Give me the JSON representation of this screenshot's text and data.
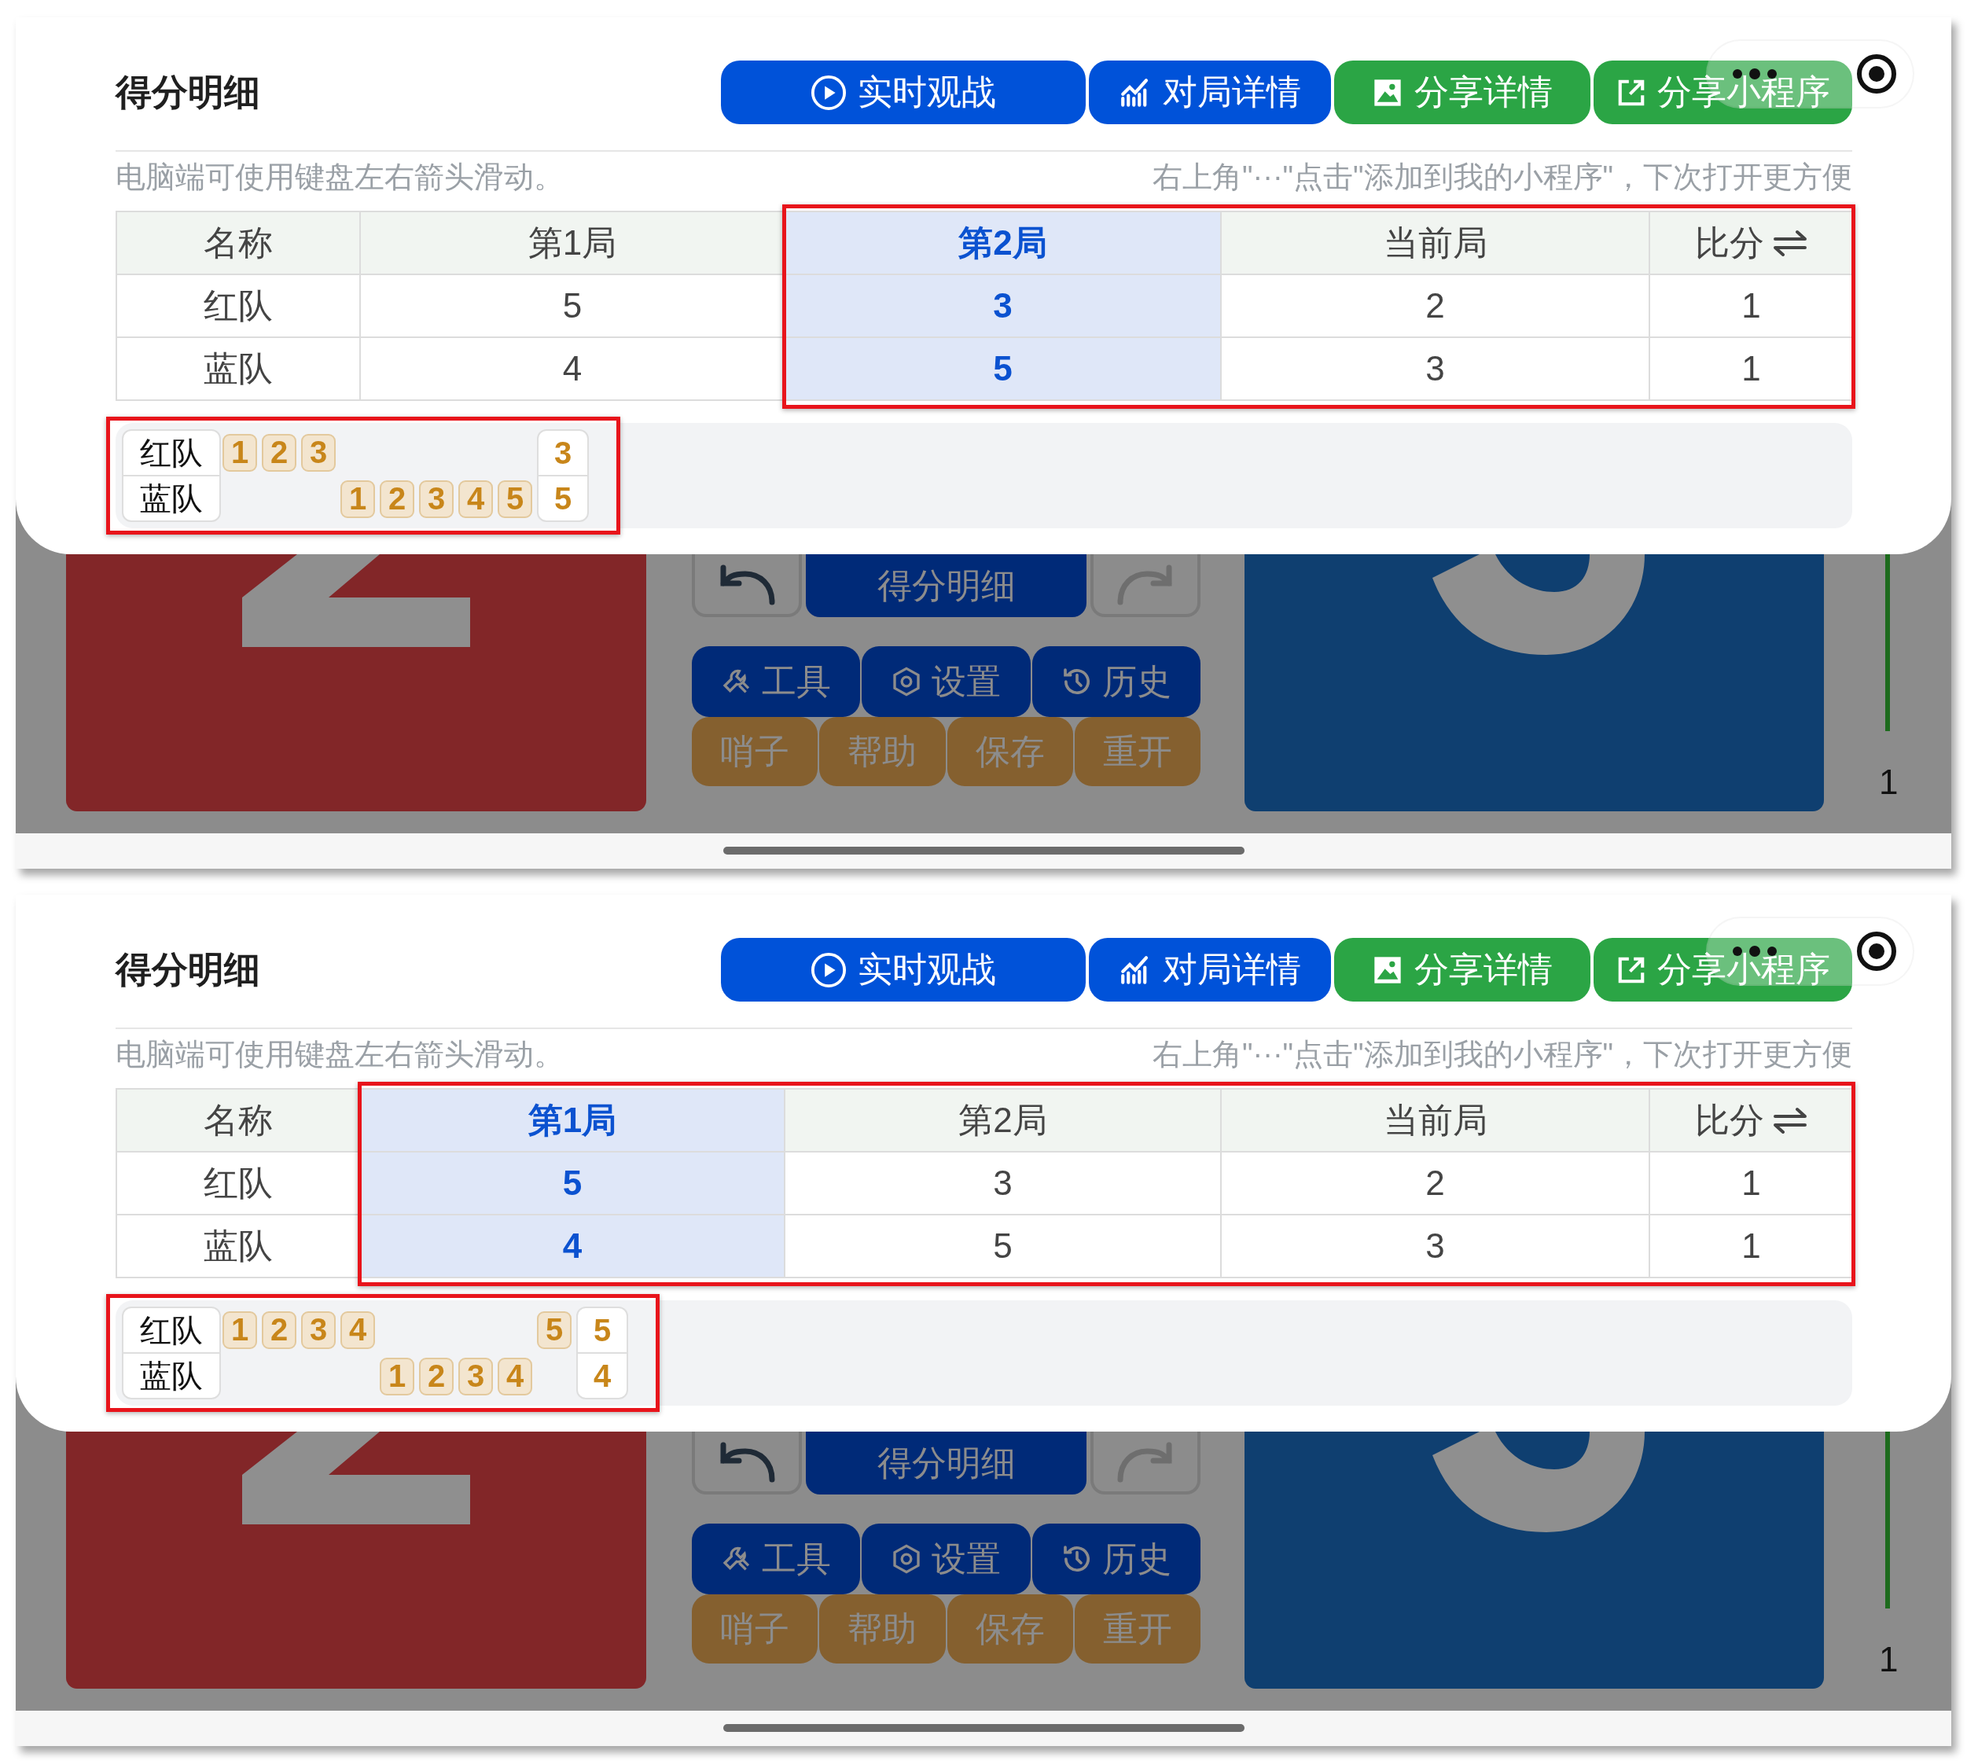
{
  "screens": [
    {
      "panel_title": "得分明细",
      "actions": [
        {
          "label": "实时观战",
          "kind": "live"
        },
        {
          "label": "对局详情",
          "kind": "stats"
        },
        {
          "label": "分享详情",
          "kind": "share-image"
        },
        {
          "label": "分享小程序",
          "kind": "share-app"
        }
      ],
      "hint_left": "电脑端可使用键盘左右箭头滑动。",
      "hint_right": "右上角\"···\"点击\"添加到我的小程序\"，下次打开更方便",
      "table": {
        "columns": [
          {
            "label": "名称",
            "selected": false
          },
          {
            "label": "第1局",
            "selected": false
          },
          {
            "label": "第2局",
            "selected": true
          },
          {
            "label": "当前局",
            "selected": false
          },
          {
            "label": "比分",
            "selected": false,
            "kind": "swap"
          }
        ],
        "rows": [
          [
            "红队",
            "5",
            "3",
            "2",
            "1"
          ],
          [
            "蓝队",
            "4",
            "5",
            "3",
            "1"
          ]
        ]
      },
      "rally_log": {
        "highlighted": true,
        "teams": [
          {
            "name": "红队",
            "cells": [
              "1",
              "2",
              "3",
              null,
              null,
              null,
              null,
              null
            ],
            "total": "3"
          },
          {
            "name": "蓝队",
            "cells": [
              null,
              null,
              null,
              "1",
              "2",
              "3",
              "4",
              "5"
            ],
            "total": "5"
          }
        ]
      },
      "board": {
        "center_button": "得分明细",
        "tools": [
          {
            "label": "工具",
            "kind": "wrench"
          },
          {
            "label": "设置",
            "kind": "settings"
          },
          {
            "label": "历史",
            "kind": "history"
          }
        ],
        "extras": [
          "哨子",
          "帮助",
          "保存",
          "重开"
        ],
        "side_count": "1"
      }
    },
    {
      "panel_title": "得分明细",
      "actions": [
        {
          "label": "实时观战",
          "kind": "live"
        },
        {
          "label": "对局详情",
          "kind": "stats"
        },
        {
          "label": "分享详情",
          "kind": "share-image"
        },
        {
          "label": "分享小程序",
          "kind": "share-app"
        }
      ],
      "hint_left": "电脑端可使用键盘左右箭头滑动。",
      "hint_right": "右上角\"···\"点击\"添加到我的小程序\"，下次打开更方便",
      "table": {
        "columns": [
          {
            "label": "名称",
            "selected": false
          },
          {
            "label": "第1局",
            "selected": true
          },
          {
            "label": "第2局",
            "selected": false
          },
          {
            "label": "当前局",
            "selected": false
          },
          {
            "label": "比分",
            "selected": false,
            "kind": "swap"
          }
        ],
        "rows": [
          [
            "红队",
            "5",
            "3",
            "2",
            "1"
          ],
          [
            "蓝队",
            "4",
            "5",
            "3",
            "1"
          ]
        ]
      },
      "rally_log": {
        "highlighted": true,
        "teams": [
          {
            "name": "红队",
            "cells": [
              "1",
              "2",
              "3",
              "4",
              null,
              null,
              null,
              null,
              "5"
            ],
            "total": "5"
          },
          {
            "name": "蓝队",
            "cells": [
              null,
              null,
              null,
              null,
              "1",
              "2",
              "3",
              "4",
              null
            ],
            "total": "4"
          }
        ]
      },
      "board": {
        "center_button": "得分明细",
        "tools": [
          {
            "label": "工具",
            "kind": "wrench"
          },
          {
            "label": "设置",
            "kind": "settings"
          },
          {
            "label": "历史",
            "kind": "history"
          }
        ],
        "extras": [
          "哨子",
          "帮助",
          "保存",
          "重开"
        ],
        "side_count": "1"
      }
    }
  ]
}
